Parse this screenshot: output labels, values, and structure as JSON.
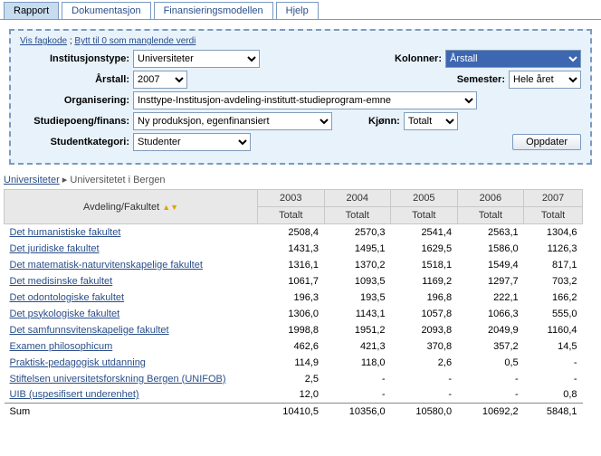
{
  "tabs": [
    "Rapport",
    "Dokumentasjon",
    "Finansieringsmodellen",
    "Hjelp"
  ],
  "active_tab": 0,
  "links": {
    "vis": "Vis fagkode",
    "bytt": "Bytt til 0 som manglende verdi"
  },
  "form": {
    "institusjonstype": {
      "label": "Institusjonstype:",
      "value": "Universiteter"
    },
    "kolonner": {
      "label": "Kolonner:",
      "value": "Årstall"
    },
    "arstall": {
      "label": "Årstall:",
      "value": "2007"
    },
    "semester": {
      "label": "Semester:",
      "value": "Hele året"
    },
    "organisering": {
      "label": "Organisering:",
      "value": "Insttype-Institusjon-avdeling-institutt-studieprogram-emne"
    },
    "studiepoeng": {
      "label": "Studiepoeng/finans:",
      "value": "Ny produksjon, egenfinansiert"
    },
    "kjonn": {
      "label": "Kjønn:",
      "value": "Totalt"
    },
    "studentkategori": {
      "label": "Studentkategori:",
      "value": "Studenter"
    },
    "oppdater": "Oppdater"
  },
  "breadcrumb": {
    "root": "Universiteter",
    "current": "Universitetet i Bergen"
  },
  "table": {
    "row_header": "Avdeling/Fakultet",
    "years": [
      "2003",
      "2004",
      "2005",
      "2006",
      "2007"
    ],
    "subheader": "Totalt",
    "rows": [
      {
        "name": "Det humanistiske fakultet",
        "v": [
          "2508,4",
          "2570,3",
          "2541,4",
          "2563,1",
          "1304,6"
        ]
      },
      {
        "name": "Det juridiske fakultet",
        "v": [
          "1431,3",
          "1495,1",
          "1629,5",
          "1586,0",
          "1126,3"
        ]
      },
      {
        "name": "Det matematisk-naturvitenskapelige fakultet",
        "v": [
          "1316,1",
          "1370,2",
          "1518,1",
          "1549,4",
          "817,1"
        ]
      },
      {
        "name": "Det medisinske fakultet",
        "v": [
          "1061,7",
          "1093,5",
          "1169,2",
          "1297,7",
          "703,2"
        ]
      },
      {
        "name": "Det odontologiske fakultet",
        "v": [
          "196,3",
          "193,5",
          "196,8",
          "222,1",
          "166,2"
        ]
      },
      {
        "name": "Det psykologiske fakultet",
        "v": [
          "1306,0",
          "1143,1",
          "1057,8",
          "1066,3",
          "555,0"
        ]
      },
      {
        "name": "Det samfunnsvitenskapelige fakultet",
        "v": [
          "1998,8",
          "1951,2",
          "2093,8",
          "2049,9",
          "1160,4"
        ]
      },
      {
        "name": "Examen philosophicum",
        "v": [
          "462,6",
          "421,3",
          "370,8",
          "357,2",
          "14,5"
        ]
      },
      {
        "name": "Praktisk-pedagogisk utdanning",
        "v": [
          "114,9",
          "118,0",
          "2,6",
          "0,5",
          "-"
        ]
      },
      {
        "name": "Stiftelsen universitetsforskning Bergen (UNIFOB)",
        "v": [
          "2,5",
          "-",
          "-",
          "-",
          "-"
        ]
      },
      {
        "name": "UIB (uspesifisert underenhet)",
        "v": [
          "12,0",
          "-",
          "-",
          "-",
          "0,8"
        ]
      }
    ],
    "sum": {
      "label": "Sum",
      "v": [
        "10410,5",
        "10356,0",
        "10580,0",
        "10692,2",
        "5848,1"
      ]
    }
  },
  "chart_data": {
    "type": "table",
    "title": "Universitetet i Bergen — Avdeling/Fakultet totals by year",
    "columns": [
      "2003",
      "2004",
      "2005",
      "2006",
      "2007"
    ],
    "series": [
      {
        "name": "Det humanistiske fakultet",
        "values": [
          2508.4,
          2570.3,
          2541.4,
          2563.1,
          1304.6
        ]
      },
      {
        "name": "Det juridiske fakultet",
        "values": [
          1431.3,
          1495.1,
          1629.5,
          1586.0,
          1126.3
        ]
      },
      {
        "name": "Det matematisk-naturvitenskapelige fakultet",
        "values": [
          1316.1,
          1370.2,
          1518.1,
          1549.4,
          817.1
        ]
      },
      {
        "name": "Det medisinske fakultet",
        "values": [
          1061.7,
          1093.5,
          1169.2,
          1297.7,
          703.2
        ]
      },
      {
        "name": "Det odontologiske fakultet",
        "values": [
          196.3,
          193.5,
          196.8,
          222.1,
          166.2
        ]
      },
      {
        "name": "Det psykologiske fakultet",
        "values": [
          1306.0,
          1143.1,
          1057.8,
          1066.3,
          555.0
        ]
      },
      {
        "name": "Det samfunnsvitenskapelige fakultet",
        "values": [
          1998.8,
          1951.2,
          2093.8,
          2049.9,
          1160.4
        ]
      },
      {
        "name": "Examen philosophicum",
        "values": [
          462.6,
          421.3,
          370.8,
          357.2,
          14.5
        ]
      },
      {
        "name": "Praktisk-pedagogisk utdanning",
        "values": [
          114.9,
          118.0,
          2.6,
          0.5,
          null
        ]
      },
      {
        "name": "Stiftelsen universitetsforskning Bergen (UNIFOB)",
        "values": [
          2.5,
          null,
          null,
          null,
          null
        ]
      },
      {
        "name": "UIB (uspesifisert underenhet)",
        "values": [
          12.0,
          null,
          null,
          null,
          0.8
        ]
      }
    ],
    "sum": [
      10410.5,
      10356.0,
      10580.0,
      10692.2,
      5848.1
    ]
  }
}
